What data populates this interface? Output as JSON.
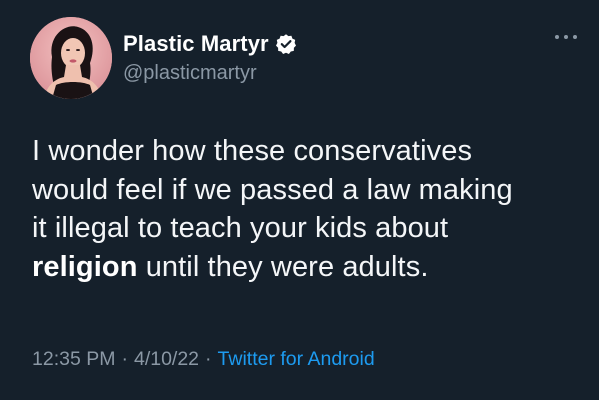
{
  "author": {
    "display_name": "Plastic Martyr",
    "handle": "@plasticmartyr",
    "verified": true,
    "avatar_icon": "profile-photo-avatar"
  },
  "tweet": {
    "lines": [
      {
        "pre": "I wonder how these conservatives",
        "bold": "",
        "post": ""
      },
      {
        "pre": "would feel if we passed a law making",
        "bold": "",
        "post": ""
      },
      {
        "pre": "it illegal to teach your kids about",
        "bold": "",
        "post": ""
      },
      {
        "pre": "",
        "bold": "religion",
        "post": " until they were adults."
      }
    ]
  },
  "meta": {
    "time": "12:35 PM",
    "separator": "·",
    "date": "4/10/22",
    "source": "Twitter for Android"
  },
  "colors": {
    "background": "#15202b",
    "primary_text": "#ffffff",
    "secondary_text": "#8b98a5",
    "link": "#1d9bf0",
    "verified_badge": "#ffffff"
  },
  "icons": {
    "more_menu": "ellipsis-horizontal-icon",
    "verified_badge": "verified-badge-icon"
  }
}
